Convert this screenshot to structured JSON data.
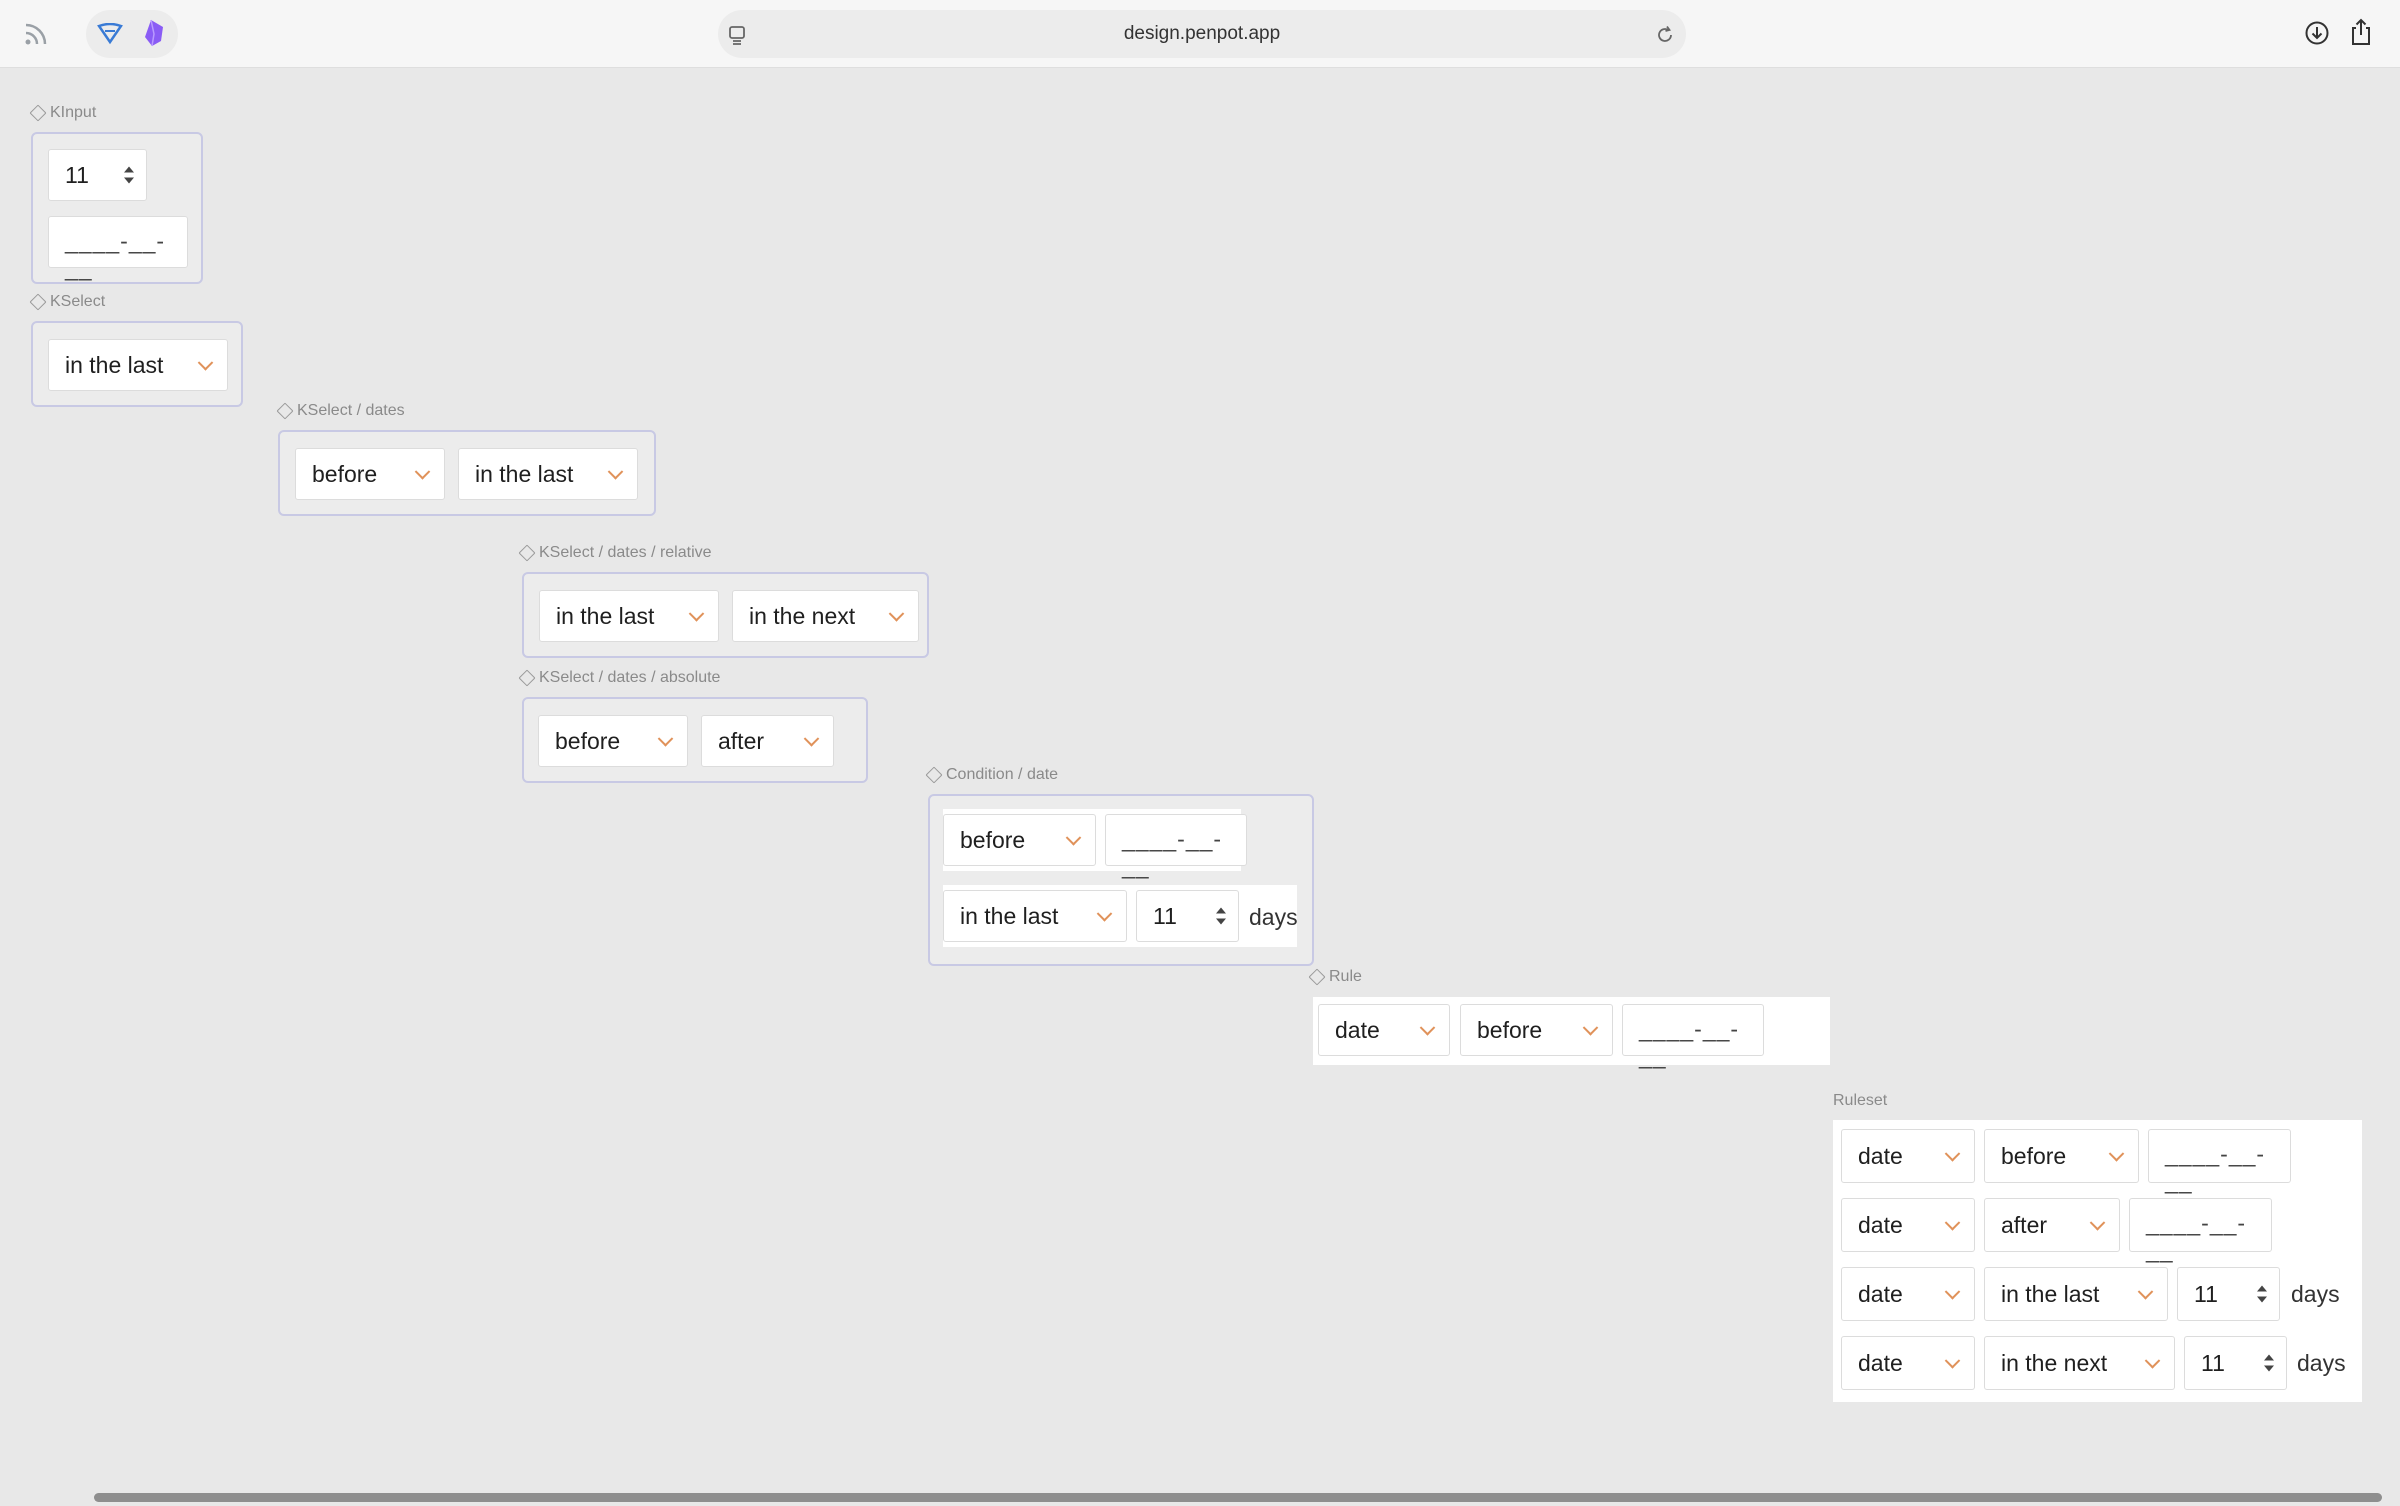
{
  "browser": {
    "url": "design.penpot.app",
    "icons": [
      "rss-icon",
      "shield-icon",
      "obsidian-icon",
      "reader-icon",
      "reload-icon",
      "download-icon",
      "share-icon"
    ]
  },
  "colors": {
    "chevron": "#e0925a",
    "frame_border": "#c8c9e4",
    "canvas": "#e8e8e8"
  },
  "frames": {
    "kinput": {
      "label": "KInput",
      "number": "11",
      "date": "____-__-__"
    },
    "kselect": {
      "label": "KSelect",
      "select": "in the last"
    },
    "kselect_dates": {
      "label": "KSelect / dates",
      "select1": "before",
      "select2": "in the last"
    },
    "kselect_relative": {
      "label": "KSelect / dates / relative",
      "select1": "in the last",
      "select2": "in the next"
    },
    "kselect_absolute": {
      "label": "KSelect / dates / absolute",
      "select1": "before",
      "select2": "after"
    },
    "condition": {
      "label": "Condition / date",
      "select1": "before",
      "date": "____-__-__",
      "select2": "in the last",
      "number": "11",
      "unit": "days"
    },
    "rule": {
      "label": "Rule",
      "field": "date",
      "op": "before",
      "date": "____-__-__"
    },
    "ruleset": {
      "label": "Ruleset",
      "rows": [
        {
          "field": "date",
          "op": "before",
          "date": "____-__-__"
        },
        {
          "field": "date",
          "op": "after",
          "date": "____-__-__"
        },
        {
          "field": "date",
          "op": "in the last",
          "number": "11",
          "unit": "days"
        },
        {
          "field": "date",
          "op": "in the next",
          "number": "11",
          "unit": "days"
        }
      ]
    }
  }
}
